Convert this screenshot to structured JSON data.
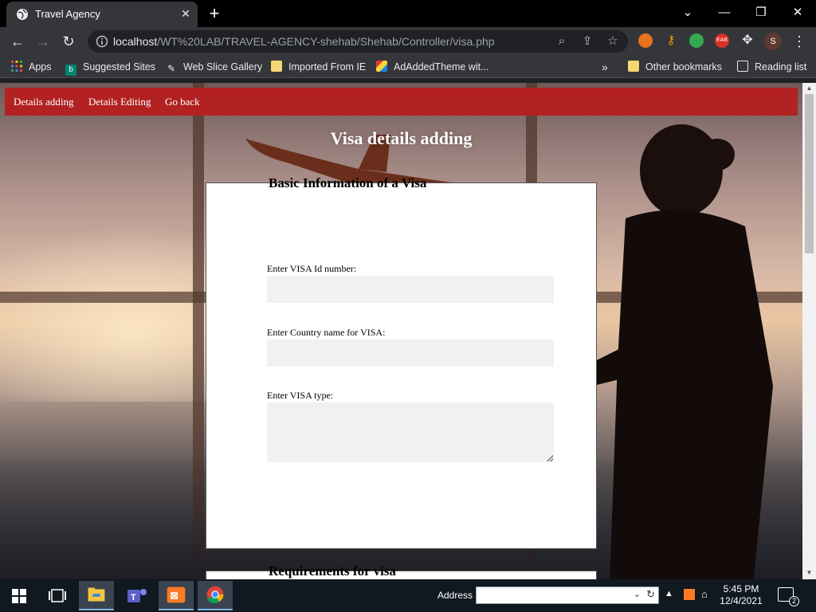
{
  "browser": {
    "tab_title": "Travel Agency",
    "url_host": "localhost",
    "url_path": "/WT%20LAB/TRAVEL-AGENCY-shehab/Shehab/Controller/visa.php",
    "profile_initial": "S",
    "bookmarks": [
      {
        "label": "Apps",
        "icon": "apps-grid-icon"
      },
      {
        "label": "Suggested Sites",
        "icon": "bing-icon"
      },
      {
        "label": "Web Slice Gallery",
        "icon": "web-slice-icon"
      },
      {
        "label": "Imported From IE",
        "icon": "folder-icon"
      },
      {
        "label": "AdAddedTheme wit...",
        "icon": "theme-icon"
      }
    ],
    "overflow": "»",
    "other_bookmarks": "Other bookmarks",
    "reading_list": "Reading list"
  },
  "page": {
    "nav": [
      "Details adding",
      "Details Editing",
      "Go back"
    ],
    "heading": "Visa details adding",
    "section1": {
      "legend": "Basic Information of a Visa",
      "fields": [
        {
          "label": "Enter VISA Id number:",
          "value": ""
        },
        {
          "label": "Enter Country name for VISA:",
          "value": ""
        },
        {
          "label": "Enter VISA type:",
          "value": ""
        }
      ]
    },
    "section2": {
      "legend": "Requirements for visa"
    },
    "colors": {
      "nav": "#b22222",
      "panel": "#ffffff",
      "input": "#f1f1f1"
    }
  },
  "taskbar": {
    "address_label": "Address",
    "time": "5:45 PM",
    "date": "12/4/2021",
    "notifications": "2"
  }
}
